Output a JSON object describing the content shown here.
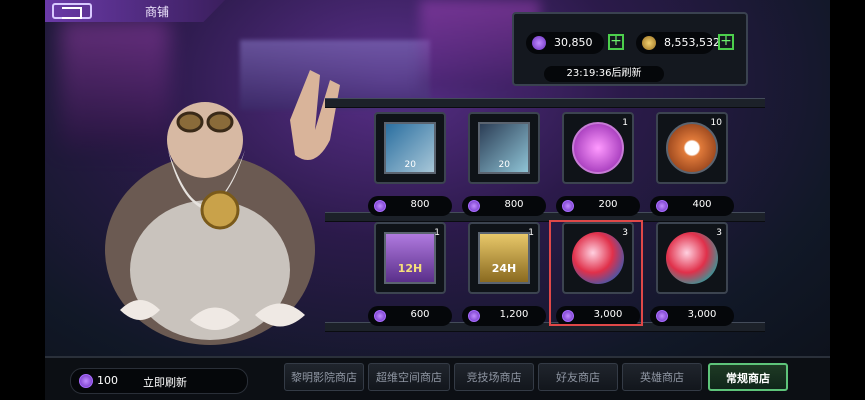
{
  "header": {
    "title": "商铺"
  },
  "currency": [
    {
      "name": "gems",
      "value": "30,850",
      "icon": "purple-gem-icon",
      "color": "#a86bff"
    },
    {
      "name": "gold",
      "value": "8,553,532",
      "icon": "gold-coin-icon",
      "color": "#d8b24a"
    }
  ],
  "timer": "23:19:36后刷新",
  "items": [
    {
      "kind": "hero-card",
      "qty": "20",
      "price": "800"
    },
    {
      "kind": "hero-card",
      "qty": "20",
      "price": "800"
    },
    {
      "kind": "purple-cap",
      "qty": "1",
      "price": "200"
    },
    {
      "kind": "orange-chip",
      "qty": "10",
      "price": "400"
    },
    {
      "kind": "purple-ticket",
      "qty": "1",
      "label": "12H",
      "price": "600"
    },
    {
      "kind": "gold-ticket",
      "qty": "1",
      "label": "24H",
      "price": "1,200"
    },
    {
      "kind": "red-orb",
      "qty": "3",
      "price": "3,000"
    },
    {
      "kind": "red-orb",
      "qty": "3",
      "price": "3,000"
    }
  ],
  "refresh": {
    "cost": "100",
    "label": "立即刷新"
  },
  "tabs": [
    {
      "label": "黎明影院商店",
      "active": false
    },
    {
      "label": "超维空间商店",
      "active": false
    },
    {
      "label": "竞技场商店",
      "active": false
    },
    {
      "label": "好友商店",
      "active": false
    },
    {
      "label": "英雄商店",
      "active": false
    },
    {
      "label": "常规商店",
      "active": true
    }
  ]
}
